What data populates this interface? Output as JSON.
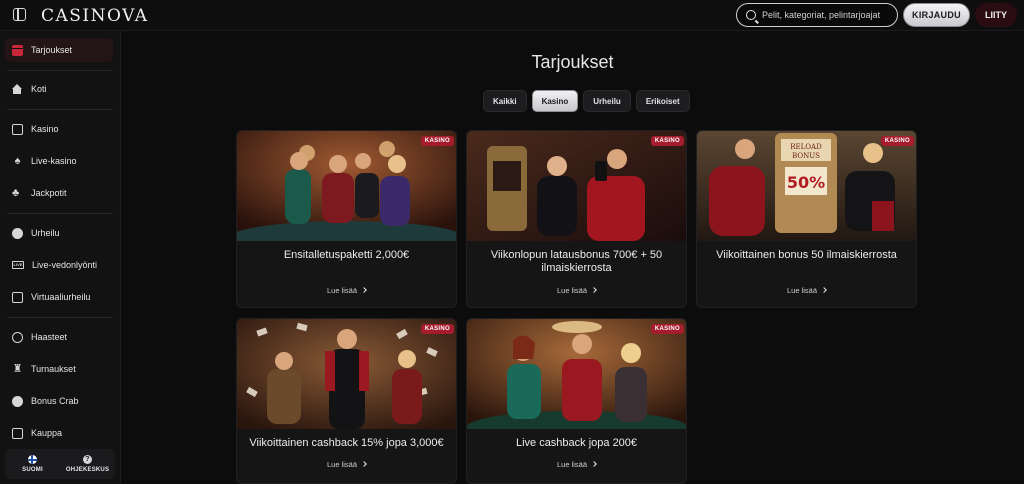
{
  "header": {
    "logo": "CASINOVA",
    "search_placeholder": "Pelit, kategoriat, pelintarjoajat",
    "login_label": "KIRJAUDU",
    "join_label": "LIITY"
  },
  "sidebar": {
    "items": [
      {
        "label": "Tarjoukset",
        "icon": "gift-icon"
      },
      {
        "label": "Koti",
        "icon": "home-icon"
      },
      {
        "label": "Kasino",
        "icon": "slot-machine-icon"
      },
      {
        "label": "Live-kasino",
        "icon": "live-dealer-icon"
      },
      {
        "label": "Jackpotit",
        "icon": "clover-icon"
      },
      {
        "label": "Urheilu",
        "icon": "soccer-ball-icon"
      },
      {
        "label": "Live-vedonlyönti",
        "icon": "live-betting-icon"
      },
      {
        "label": "Virtuaaliurheilu",
        "icon": "virtual-sports-icon"
      },
      {
        "label": "Haasteet",
        "icon": "medal-icon"
      },
      {
        "label": "Turnaukset",
        "icon": "trophy-icon"
      },
      {
        "label": "Bonus Crab",
        "icon": "crab-icon"
      },
      {
        "label": "Kauppa",
        "icon": "shop-icon"
      }
    ],
    "language_label": "SUOMI",
    "help_label": "OHJEKESKUS"
  },
  "main": {
    "title": "Tarjoukset",
    "tabs": [
      {
        "label": "Kaikki",
        "active": false
      },
      {
        "label": "Kasino",
        "active": true
      },
      {
        "label": "Urheilu",
        "active": false
      },
      {
        "label": "Erikoiset",
        "active": false
      }
    ],
    "cards": [
      {
        "badge": "KASINO",
        "title": "Ensitalletuspaketti 2,000€",
        "link": "Lue lisää"
      },
      {
        "badge": "KASINO",
        "title": "Viikonlopun latausbonus 700€ + 50 ilmaiskierrosta",
        "link": "Lue lisää"
      },
      {
        "badge": "KASINO",
        "title": "Viikoittainen bonus 50 ilmaiskierrosta",
        "link": "Lue lisää",
        "image_text_1": "RELOAD",
        "image_text_2": "BONUS",
        "image_text_3": "50%"
      },
      {
        "badge": "KASINO",
        "title": "Viikoittainen cashback 15% jopa 3,000€",
        "link": "Lue lisää"
      },
      {
        "badge": "KASINO",
        "title": "Live cashback jopa 200€",
        "link": "Lue lisää"
      }
    ]
  },
  "colors": {
    "accent_red": "#a51c2d",
    "background": "#0c0c0d",
    "sidebar": "#121213"
  }
}
